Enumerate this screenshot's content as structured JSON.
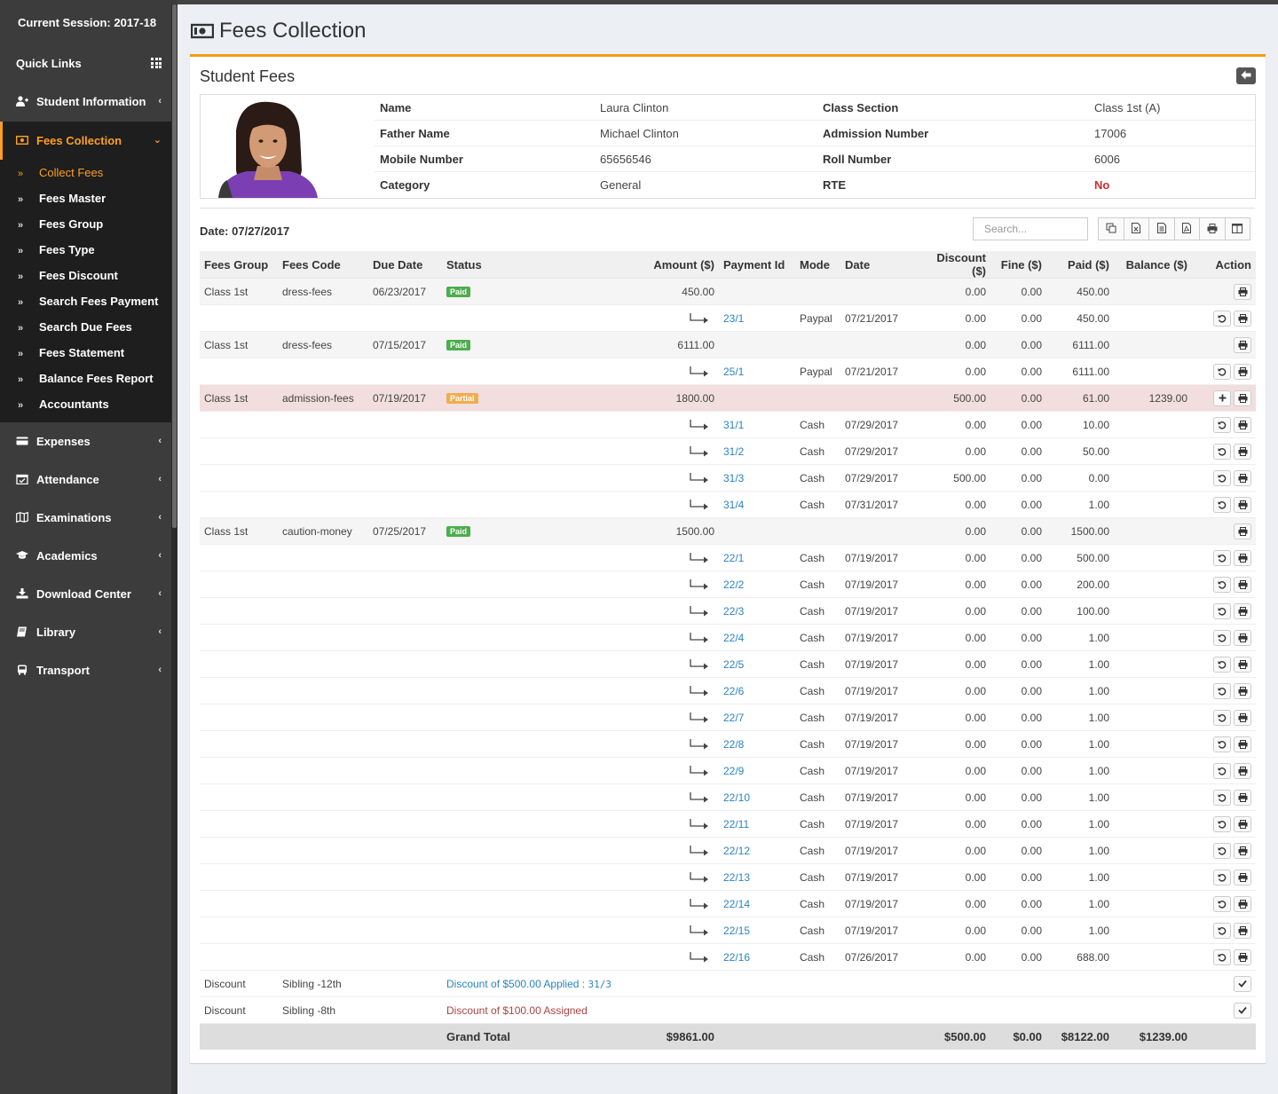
{
  "session": "Current Session: 2017-18",
  "nav": {
    "quick_links": "Quick Links",
    "student_information": "Student Information",
    "fees_collection": "Fees Collection",
    "sub": [
      "Collect Fees",
      "Fees Master",
      "Fees Group",
      "Fees Type",
      "Fees Discount",
      "Search Fees Payment",
      "Search Due Fees",
      "Fees Statement",
      "Balance Fees Report",
      "Accountants"
    ],
    "rest": [
      "Expenses",
      "Attendance",
      "Examinations",
      "Academics",
      "Download Center",
      "Library",
      "Transport"
    ]
  },
  "page_title": "Fees Collection",
  "box_title": "Student Fees",
  "student": {
    "name_label": "Name",
    "name": "Laura Clinton",
    "class_label": "Class Section",
    "class": "Class 1st (A)",
    "father_label": "Father Name",
    "father": "Michael Clinton",
    "admission_label": "Admission Number",
    "admission": "17006",
    "mobile_label": "Mobile Number",
    "mobile": "65656546",
    "roll_label": "Roll Number",
    "roll": "6006",
    "category_label": "Category",
    "category": "General",
    "rte_label": "RTE",
    "rte": "No"
  },
  "date_line": "Date: 07/27/2017",
  "search_placeholder": "Search...",
  "columns": [
    "Fees Group",
    "Fees Code",
    "Due Date",
    "Status",
    "Amount ($)",
    "Payment Id",
    "Mode",
    "Date",
    "Discount ($)",
    "Fine ($)",
    "Paid ($)",
    "Balance ($)",
    "Action"
  ],
  "fees": [
    {
      "group": "Class 1st",
      "code": "dress-fees",
      "due": "06/23/2017",
      "status": "Paid",
      "amount": "450.00",
      "discount": "0.00",
      "fine": "0.00",
      "paid": "450.00",
      "balance": "",
      "partial": false,
      "payments": [
        [
          "23/1",
          "Paypal",
          "07/21/2017",
          "0.00",
          "0.00",
          "450.00"
        ]
      ]
    },
    {
      "group": "Class 1st",
      "code": "dress-fees",
      "due": "07/15/2017",
      "status": "Paid",
      "amount": "6111.00",
      "discount": "0.00",
      "fine": "0.00",
      "paid": "6111.00",
      "balance": "",
      "partial": false,
      "payments": [
        [
          "25/1",
          "Paypal",
          "07/21/2017",
          "0.00",
          "0.00",
          "6111.00"
        ]
      ]
    },
    {
      "group": "Class 1st",
      "code": "admission-fees",
      "due": "07/19/2017",
      "status": "Partial",
      "amount": "1800.00",
      "discount": "500.00",
      "fine": "0.00",
      "paid": "61.00",
      "balance": "1239.00",
      "partial": true,
      "payments": [
        [
          "31/1",
          "Cash",
          "07/29/2017",
          "0.00",
          "0.00",
          "10.00"
        ],
        [
          "31/2",
          "Cash",
          "07/29/2017",
          "0.00",
          "0.00",
          "50.00"
        ],
        [
          "31/3",
          "Cash",
          "07/29/2017",
          "500.00",
          "0.00",
          "0.00"
        ],
        [
          "31/4",
          "Cash",
          "07/31/2017",
          "0.00",
          "0.00",
          "1.00"
        ]
      ]
    },
    {
      "group": "Class 1st",
      "code": "caution-money",
      "due": "07/25/2017",
      "status": "Paid",
      "amount": "1500.00",
      "discount": "0.00",
      "fine": "0.00",
      "paid": "1500.00",
      "balance": "",
      "partial": false,
      "payments": [
        [
          "22/1",
          "Cash",
          "07/19/2017",
          "0.00",
          "0.00",
          "500.00"
        ],
        [
          "22/2",
          "Cash",
          "07/19/2017",
          "0.00",
          "0.00",
          "200.00"
        ],
        [
          "22/3",
          "Cash",
          "07/19/2017",
          "0.00",
          "0.00",
          "100.00"
        ],
        [
          "22/4",
          "Cash",
          "07/19/2017",
          "0.00",
          "0.00",
          "1.00"
        ],
        [
          "22/5",
          "Cash",
          "07/19/2017",
          "0.00",
          "0.00",
          "1.00"
        ],
        [
          "22/6",
          "Cash",
          "07/19/2017",
          "0.00",
          "0.00",
          "1.00"
        ],
        [
          "22/7",
          "Cash",
          "07/19/2017",
          "0.00",
          "0.00",
          "1.00"
        ],
        [
          "22/8",
          "Cash",
          "07/19/2017",
          "0.00",
          "0.00",
          "1.00"
        ],
        [
          "22/9",
          "Cash",
          "07/19/2017",
          "0.00",
          "0.00",
          "1.00"
        ],
        [
          "22/10",
          "Cash",
          "07/19/2017",
          "0.00",
          "0.00",
          "1.00"
        ],
        [
          "22/11",
          "Cash",
          "07/19/2017",
          "0.00",
          "0.00",
          "1.00"
        ],
        [
          "22/12",
          "Cash",
          "07/19/2017",
          "0.00",
          "0.00",
          "1.00"
        ],
        [
          "22/13",
          "Cash",
          "07/19/2017",
          "0.00",
          "0.00",
          "1.00"
        ],
        [
          "22/14",
          "Cash",
          "07/19/2017",
          "0.00",
          "0.00",
          "1.00"
        ],
        [
          "22/15",
          "Cash",
          "07/19/2017",
          "0.00",
          "0.00",
          "1.00"
        ],
        [
          "22/16",
          "Cash",
          "07/26/2017",
          "0.00",
          "0.00",
          "688.00"
        ]
      ]
    }
  ],
  "discounts": [
    {
      "group": "Discount",
      "code": "Sibling -12th",
      "text": "Discount of $500.00 Applied : ",
      "ref": "31/3",
      "kind": "applied"
    },
    {
      "group": "Discount",
      "code": "Sibling -8th",
      "text": "Discount of $100.00 Assigned",
      "ref": "",
      "kind": "assigned"
    }
  ],
  "total": {
    "label": "Grand Total",
    "amount": "$9861.00",
    "discount": "$500.00",
    "fine": "$0.00",
    "paid": "$8122.00",
    "balance": "$1239.00"
  },
  "colors": {
    "accent": "#ff9f22",
    "box_border": "#f39c12",
    "link": "#2c83c1",
    "partial_row": "#f2dede",
    "paid_badge": "#4cae4c",
    "partial_badge": "#f0ad4e"
  }
}
